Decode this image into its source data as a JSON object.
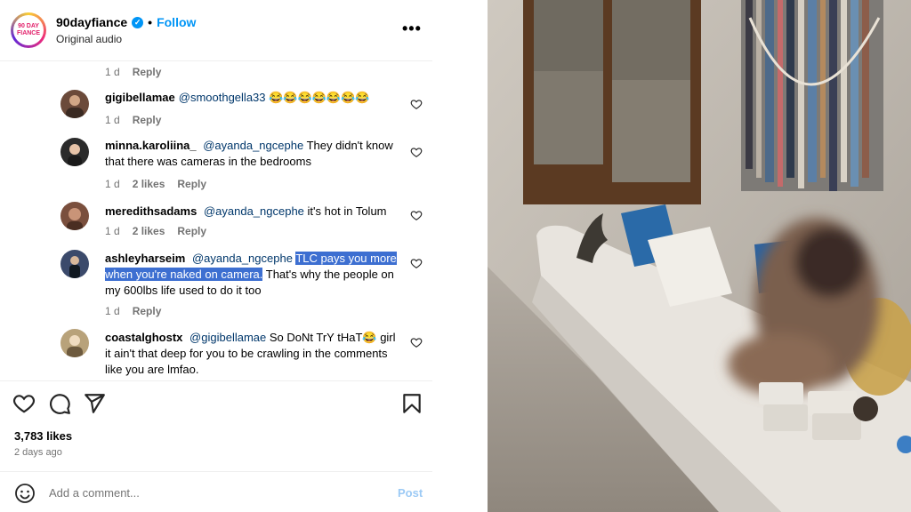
{
  "header": {
    "logo_text": "90 DAY FIANCE",
    "username": "90dayfiance",
    "verified_mark": "✓",
    "dot": "•",
    "follow_label": "Follow",
    "audio": "Original audio",
    "more": "•••"
  },
  "top_meta": {
    "age": "1 d",
    "reply": "Reply"
  },
  "comments": [
    {
      "user": "gigibellamae",
      "mention": "@smoothgella33",
      "text": "😂😂😂😂😂😂😂",
      "age": "1 d",
      "reply": "Reply",
      "avatar_color": "#6b4a3a"
    },
    {
      "user": "minna.karoliina_",
      "mention": "@ayanda_ngcephe",
      "text": "They didn't know that there was cameras in the bedrooms",
      "age": "1 d",
      "likes": "2 likes",
      "reply": "Reply",
      "avatar_color": "#2b2b2b"
    },
    {
      "user": "meredithsadams",
      "mention": "@ayanda_ngcephe",
      "text": "it's hot in Tolum",
      "age": "1 d",
      "likes": "2 likes",
      "reply": "Reply",
      "avatar_color": "#7a4f3d"
    },
    {
      "user": "ashleyharseim",
      "mention": "@ayanda_ngcephe",
      "highlight": "TLC pays you more when you're naked on camera.",
      "text": "That's why the people on my 600lbs life used to do it too",
      "age": "1 d",
      "reply": "Reply",
      "avatar_color": "#3b4a6b"
    },
    {
      "user": "coastalghostx",
      "mention": "@gigibellamae",
      "text": "So DoNt TrY tHaT😂 girl it ain't that deep for you to be crawling in the comments like you are lmfao.",
      "avatar_color": "#b8a27a"
    }
  ],
  "footer": {
    "likes": "3,783 likes",
    "date": "2 days ago",
    "comment_placeholder": "Add a comment...",
    "post_label": "Post"
  },
  "colors": {
    "accent": "#0095f6",
    "mention": "#00376b",
    "highlight": "#3d6fd1",
    "muted": "#737373"
  },
  "icons": [
    "more-options-icon",
    "heart-icon",
    "comment-icon",
    "share-icon",
    "save-icon",
    "emoji-icon"
  ]
}
